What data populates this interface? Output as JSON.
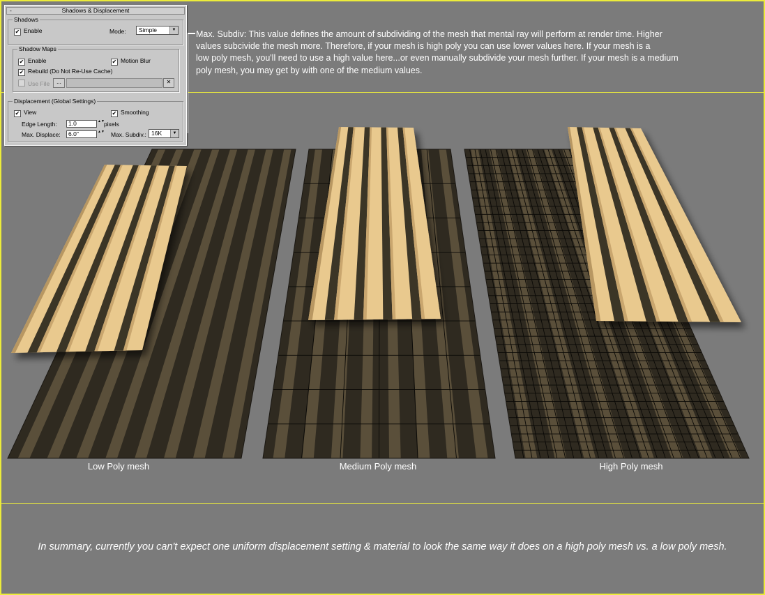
{
  "panel": {
    "title": "Shadows & Displacement",
    "collapse": "-",
    "shadows": {
      "group": "Shadows",
      "enable": "Enable",
      "mode_label": "Mode:",
      "mode_value": "Simple"
    },
    "shadow_maps": {
      "group": "Shadow Maps",
      "enable": "Enable",
      "motion_blur": "Motion Blur",
      "rebuild": "Rebuild (Do Not Re-Use Cache)",
      "use_file": "Use File",
      "browse": "...",
      "clear": "✕"
    },
    "displacement": {
      "group": "Displacement (Global Settings)",
      "view": "View",
      "smoothing": "Smoothing",
      "edge_length_label": "Edge Length:",
      "edge_length_value": "1.0",
      "edge_length_unit": "pixels",
      "max_displace_label": "Max. Displace:",
      "max_displace_value": "6.0\"",
      "max_subdiv_label": "Max. Subdiv.:",
      "max_subdiv_value": "16K"
    },
    "check": "✔",
    "spin": "▲▼",
    "arrow": "▼"
  },
  "annotation": {
    "line1": "Max. Subdiv:  This value defines the amount of subdividing of the mesh that mental ray will perform at render time.  Higher",
    "line2": "values subcivide the mesh more.  Therefore, if your mesh is high poly you can use lower values here.  If your mesh is a",
    "line3": "low poly mesh, you'll need to use a high value here...or even manually subdivide your mesh further.  If your mesh is a medium",
    "line4": "poly mesh, you may get by with one of the medium values."
  },
  "captions": {
    "low": "Low Poly mesh",
    "medium": "Medium Poly mesh",
    "high": "High Poly mesh"
  },
  "summary": "In summary, currently you can't expect one uniform displacement setting & material to look the same way it does on a high poly mesh vs. a low poly mesh.",
  "colors": {
    "background": "#7b7b7b",
    "frame": "#ecec3a",
    "wood_light": "#e9c98e",
    "wood_dark": "#3a3426",
    "floor_dark": "#2f2a20",
    "floor_light": "#5a4f3a"
  },
  "mesh_grid": {
    "low": {
      "cols": 1,
      "rows": 1
    },
    "medium": {
      "cols": 6,
      "rows": 9
    },
    "high": {
      "cols": 28,
      "rows": 38
    }
  }
}
